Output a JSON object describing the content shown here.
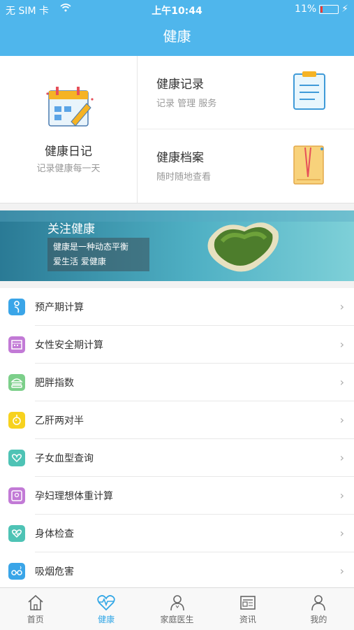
{
  "status": {
    "carrier": "无 SIM 卡",
    "time": "上午10:44",
    "battery": "11%"
  },
  "nav": {
    "title": "健康"
  },
  "diary": {
    "title": "健康日记",
    "subtitle": "记录健康每一天"
  },
  "cards": [
    {
      "title": "健康记录",
      "subtitle": "记录 管理 服务",
      "icon": "clipboard-icon"
    },
    {
      "title": "健康档案",
      "subtitle": "随时随地查看",
      "icon": "file-icon"
    }
  ],
  "banner": {
    "title": "关注健康",
    "line1": "健康是一种动态平衡",
    "line2": "爱生活    爱健康"
  },
  "list": [
    {
      "label": "预产期计算",
      "color": "#3aa5e8",
      "icon": "pregnancy-icon"
    },
    {
      "label": "女性安全期计算",
      "color": "#c27ad6",
      "icon": "calendar-icon"
    },
    {
      "label": "肥胖指数",
      "color": "#7ccf8a",
      "icon": "burger-icon"
    },
    {
      "label": "乙肝两对半",
      "color": "#f7d21e",
      "icon": "virus-icon"
    },
    {
      "label": "子女血型查询",
      "color": "#4ec3b5",
      "icon": "blood-type-icon"
    },
    {
      "label": "孕妇理想体重计算",
      "color": "#c27ad6",
      "icon": "scale-icon"
    },
    {
      "label": "身体检查",
      "color": "#4ec3b5",
      "icon": "checkup-icon"
    },
    {
      "label": "吸烟危害",
      "color": "#3aa5e8",
      "icon": "smoking-icon"
    }
  ],
  "tabs": [
    {
      "label": "首页",
      "icon": "home-icon"
    },
    {
      "label": "健康",
      "icon": "heartbeat-icon",
      "active": true
    },
    {
      "label": "家庭医生",
      "icon": "doctor-icon"
    },
    {
      "label": "资讯",
      "icon": "news-icon"
    },
    {
      "label": "我的",
      "icon": "user-icon"
    }
  ],
  "colors": {
    "accent": "#4fb6ec",
    "tab_active": "#33a7e6"
  }
}
